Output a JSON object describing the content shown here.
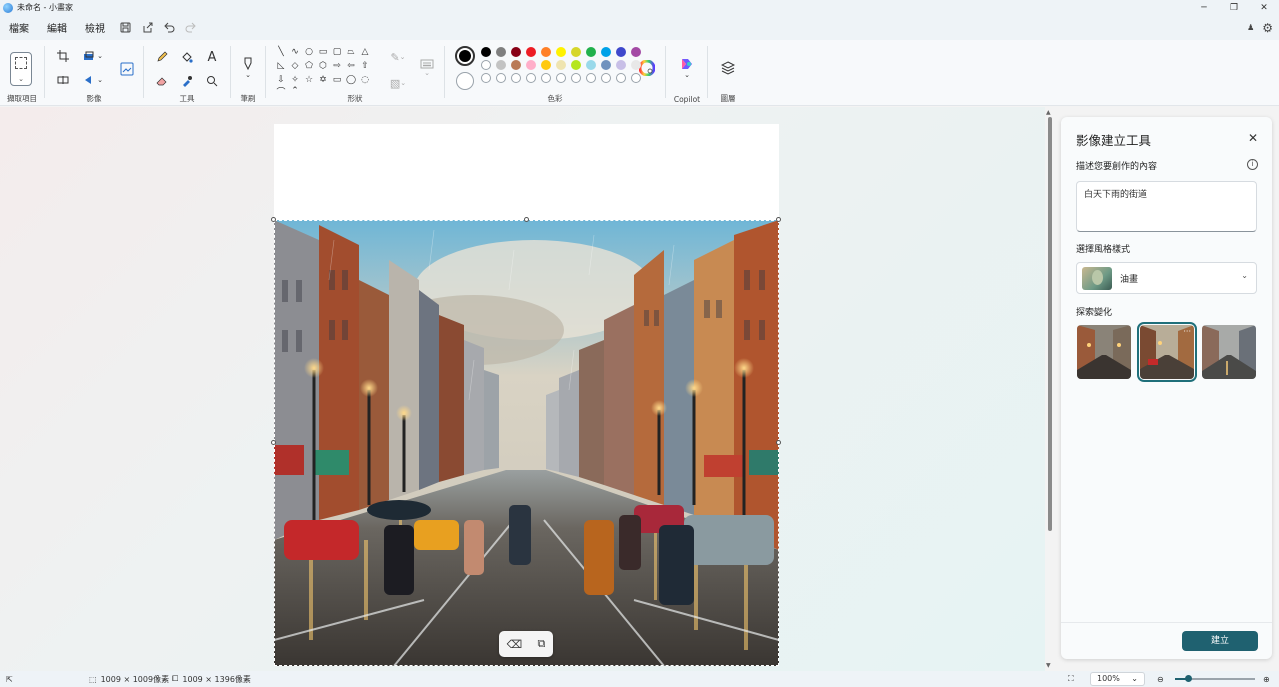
{
  "window": {
    "title": "未命名 - 小畫家",
    "controls": {
      "minimize": "─",
      "maximize": "❐",
      "close": "✕"
    }
  },
  "menu": {
    "items": [
      "檔案",
      "編輯",
      "檢視"
    ],
    "quick_icons": [
      "save-icon",
      "share-icon",
      "undo-icon",
      "redo-icon"
    ],
    "right_icons": [
      "account-icon",
      "settings-icon"
    ]
  },
  "ribbon": {
    "groups": {
      "select": "擷取項目",
      "image": "影像",
      "tools": "工具",
      "brush": "筆刷",
      "shapes": "形狀",
      "colors": "色彩",
      "copilot": "Copilot",
      "layers": "圖層"
    },
    "colors": {
      "primary": "#000000",
      "secondary": "#ffffff",
      "row1": [
        "#000000",
        "#7f7f7f",
        "#880015",
        "#ed1c24",
        "#ff7f27",
        "#fff200",
        "#d6d62a",
        "#22b14c",
        "#00a2e8",
        "#3f48cc",
        "#a349a4"
      ],
      "row2": [
        "#ffffff",
        "#c3c3c3",
        "#b97a57",
        "#ffaec9",
        "#ffc90e",
        "#efe4b0",
        "#b5e61d",
        "#99d9ea",
        "#7092be",
        "#c8bfe7",
        "#e8e8e8"
      ]
    }
  },
  "panel": {
    "title": "影像建立工具",
    "describe_label": "描述您要創作的內容",
    "prompt_value": "白天下雨的街道",
    "style_label": "選擇風格樣式",
    "style_value": "油畫",
    "variations_label": "探索變化",
    "create_button": "建立"
  },
  "status": {
    "selection_size": "1009 × 1009像素",
    "canvas_size": "1009 × 1396像素",
    "zoom": "100%"
  }
}
